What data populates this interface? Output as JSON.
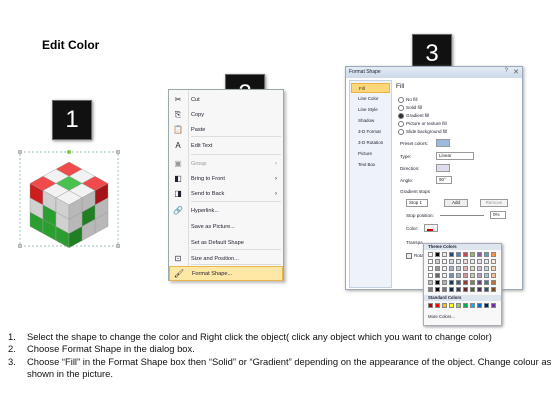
{
  "heading": "Edit Color",
  "badges": [
    "1",
    "2",
    "3"
  ],
  "context_menu": {
    "items": [
      {
        "label": "Cut",
        "icon": "scissors-icon",
        "glyph": "✂"
      },
      {
        "label": "Copy",
        "icon": "copy-icon",
        "glyph": "⎘"
      },
      {
        "label": "Paste",
        "icon": "paste-icon",
        "glyph": "📋"
      },
      {
        "label": "Edit Text",
        "icon": "edit-text-icon",
        "glyph": "A"
      },
      {
        "label": "Group",
        "icon": "group-icon",
        "glyph": "▣",
        "disabled": true,
        "submenu": true
      },
      {
        "label": "Bring to Front",
        "icon": "bring-front-icon",
        "glyph": "◧",
        "submenu": true
      },
      {
        "label": "Send to Back",
        "icon": "send-back-icon",
        "glyph": "◨",
        "submenu": true
      },
      {
        "label": "Hyperlink...",
        "icon": "hyperlink-icon",
        "glyph": "🔗"
      },
      {
        "label": "Save as Picture...",
        "icon": "",
        "glyph": ""
      },
      {
        "label": "Set as Default Shape",
        "icon": "",
        "glyph": ""
      },
      {
        "label": "Size and Position...",
        "icon": "size-position-icon",
        "glyph": "⊡"
      },
      {
        "label": "Format Shape...",
        "icon": "format-shape-icon",
        "glyph": "🖌",
        "highlighted": true
      }
    ]
  },
  "format_dialog": {
    "title": "Format Shape",
    "nav": [
      "Fill",
      "Line Color",
      "Line Style",
      "Shadow",
      "3-D Format",
      "3-D Rotation",
      "Picture",
      "Text Box"
    ],
    "section": "Fill",
    "fill_options": [
      "No fill",
      "Solid fill",
      "Gradient fill",
      "Picture or texture fill",
      "Slide background fill"
    ],
    "preset_colors_label": "Preset colors:",
    "type_label": "Type:",
    "type_value": "Linear",
    "direction_label": "Direction:",
    "angle_label": "Angle:",
    "angle_value": "90°",
    "gradient_stops_label": "Gradient stops",
    "stop_value": "Stop 1",
    "add_button": "Add",
    "remove_button": "Remove",
    "stop_position_label": "Stop position:",
    "stop_position_value": "0%",
    "color_label": "Color:",
    "transparency_label": "Transpa",
    "rotate_label": "Rotate"
  },
  "theme_colors": {
    "header": "Theme Colors",
    "standard_header": "Standard Colors",
    "more": "More Colors...",
    "top_row": [
      "#ffffff",
      "#000000",
      "#eeece1",
      "#1f497d",
      "#4f81bd",
      "#c0504d",
      "#9bbb59",
      "#8064a2",
      "#4bacc6",
      "#f79646"
    ],
    "standard": [
      "#c00000",
      "#ff0000",
      "#ffc000",
      "#ffff00",
      "#92d050",
      "#00b050",
      "#00b0f0",
      "#0070c0",
      "#002060",
      "#7030a0"
    ]
  },
  "instructions": [
    {
      "num": "1.",
      "text": "Select the shape to change the color and Right click the object( click any object which you want to change color)"
    },
    {
      "num": "2.",
      "text": "Choose Format Shape in the dialog box."
    },
    {
      "num": "3.",
      "text": "Choose “Fill” in the Format Shape box then “Solid” or “Gradient” depending on the appearance of the object. Change colour as shown in the picture."
    }
  ]
}
